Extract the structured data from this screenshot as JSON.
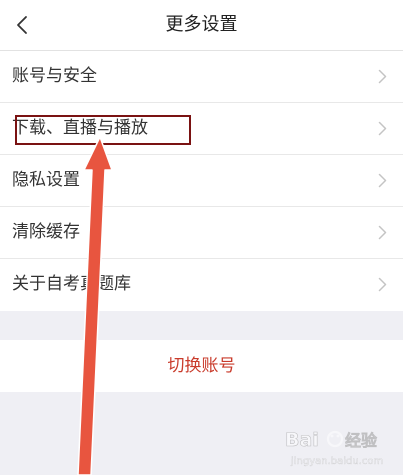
{
  "header": {
    "title": "更多设置",
    "back_icon": "chevron-left-icon"
  },
  "settings": {
    "items": [
      {
        "label": "账号与安全"
      },
      {
        "label": "下载、直播与播放"
      },
      {
        "label": "隐私设置"
      },
      {
        "label": "清除缓存"
      },
      {
        "label": "关于自考真题库"
      }
    ]
  },
  "actions": {
    "switch_account_label": "切换账号"
  },
  "colors": {
    "accent": "#c93b2b",
    "annotation_box": "#7a1212",
    "annotation_arrow": "#e8553f",
    "background": "#efeff4"
  }
}
